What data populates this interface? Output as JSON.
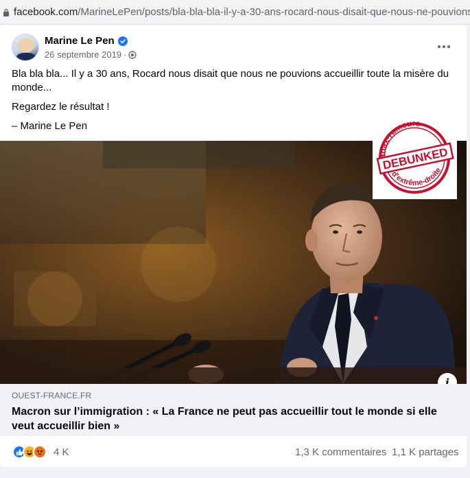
{
  "browser": {
    "url_host": "facebook.com",
    "url_path": "/MarineLePen/posts/bla-bla-bla-il-y-a-30-ans-rocard-nous-disait-que-nous-ne-pouvions-accueillir"
  },
  "post": {
    "author": "Marine Le Pen",
    "date": "26 septembre 2019",
    "date_separator": "·",
    "text_line1": "Bla bla bla... Il y a 30 ans, Rocard nous disait que nous ne pouvions accueillir toute la misère du monde...",
    "text_line2": "Regardez le résultat !",
    "text_line3": "– Marine Le Pen"
  },
  "stamp": {
    "top_text": "Hoax-rumeurs",
    "middle_text": "DEBUNKED",
    "bottom_text": "d'extrême-droite",
    "color": "#c8102e"
  },
  "link_preview": {
    "domain": "OUEST-FRANCE.FR",
    "title": "Macron sur l’immigration : « La France ne peut pas accueillir tout le monde si elle veut accueillir bien »",
    "info_icon": "i"
  },
  "stats": {
    "reaction_count": "4 K",
    "comments": "1,3 K commentaires",
    "shares": "1,1 K partages"
  },
  "colors": {
    "facebook_blue": "#1877f2",
    "secondary_text": "#65676b",
    "card_background": "#f0f2f5"
  },
  "icons": [
    "lock-icon",
    "verified-badge-icon",
    "globe-icon",
    "more-options-icon",
    "info-icon",
    "like-reaction-icon",
    "haha-reaction-icon",
    "angry-reaction-icon"
  ]
}
